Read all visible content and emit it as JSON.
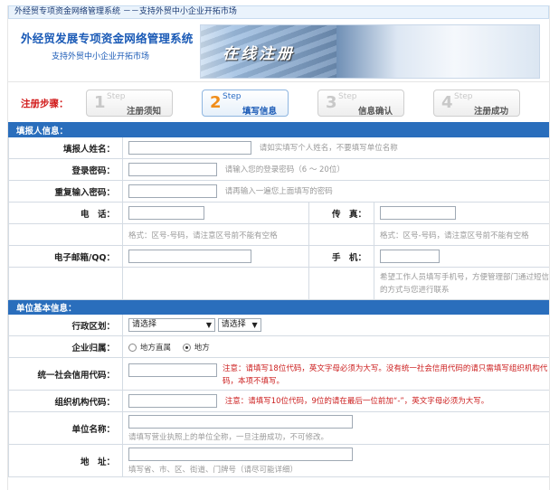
{
  "topbar": {
    "title": "外经贸专项资金网络管理系统 －－支持外贸中小企业开拓市场"
  },
  "banner": {
    "title": "外经贸发展专项资金网络管理系统",
    "subtitle": "支持外贸中小企业开拓市场",
    "graphic_text": "在线注册"
  },
  "steps": {
    "label": "注册步骤：",
    "items": [
      {
        "num": "1",
        "word": "Step",
        "name": "注册须知"
      },
      {
        "num": "2",
        "word": "Step",
        "name": "填写信息"
      },
      {
        "num": "3",
        "word": "Step",
        "name": "信息确认"
      },
      {
        "num": "4",
        "word": "Step",
        "name": "注册成功"
      }
    ]
  },
  "section1": {
    "title": "填报人信息："
  },
  "fields": {
    "name": {
      "label": "填报人姓名：",
      "hint": "请如实填写个人姓名，不要填写单位名称"
    },
    "password": {
      "label": "登录密码：",
      "hint": "请输入您的登录密码（6 ～ 20位）"
    },
    "repeat": {
      "label": "重复输入密码：",
      "hint": "请再输入一遍您上面填写的密码"
    },
    "phone": {
      "label": "电　话：",
      "format": "格式：区号-号码，请注意区号前不能有空格"
    },
    "fax": {
      "label": "传　真：",
      "format": "格式：区号-号码，请注意区号前不能有空格"
    },
    "email": {
      "label": "电子邮箱/QQ："
    },
    "mobile": {
      "label": "手　机：",
      "hint": "希望工作人员填写手机号，方便管理部门通过短信的方式与您进行联系"
    }
  },
  "section2": {
    "title": "单位基本信息："
  },
  "unit": {
    "region": {
      "label": "行政区划：",
      "select1": "请选择",
      "select2": "请选择"
    },
    "belong": {
      "label": "企业归属：",
      "option1": "地方直属",
      "option2": "地方"
    },
    "credit": {
      "label": "统一社会信用代码：",
      "warn": "注意：请填写18位代码，英文字母必须为大写。没有统一社会信用代码的请只需填写组织机构代码，本项不填写。"
    },
    "org": {
      "label": "组织机构代码：",
      "warn": "注意：请填写10位代码，9位的请在最后一位前加“-”，英文字母必须为大写。"
    },
    "unitname": {
      "label": "单位名称：",
      "hint": "请填写营业执照上的单位全称，一旦注册成功，不可修改。"
    },
    "address": {
      "label": "地　址：",
      "hint": "填写省、市、区、街道、门牌号（请尽可能详细）"
    }
  }
}
